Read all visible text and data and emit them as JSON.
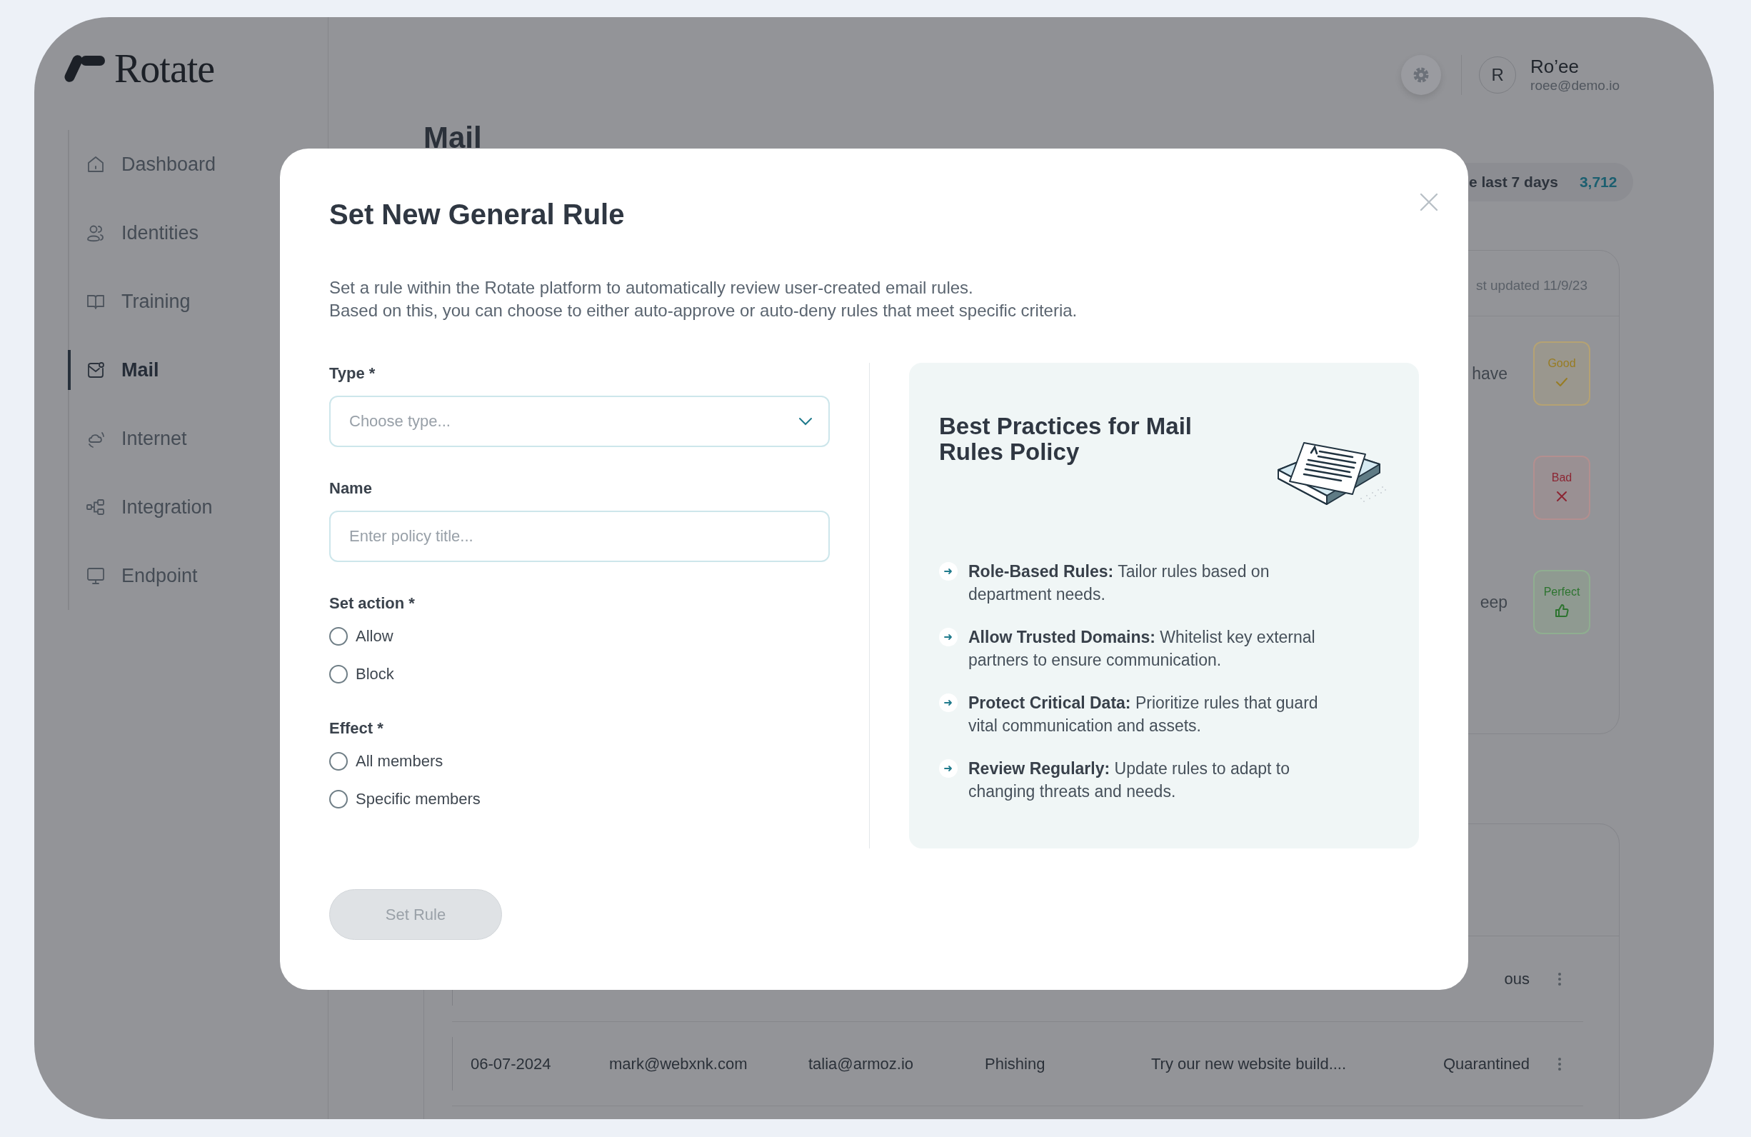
{
  "brand": {
    "name": "Rotate"
  },
  "sidebar": {
    "items": [
      {
        "label": "Dashboard",
        "selected": false
      },
      {
        "label": "Identities",
        "selected": false
      },
      {
        "label": "Training",
        "selected": false
      },
      {
        "label": "Mail",
        "selected": true
      },
      {
        "label": "Internet",
        "selected": false
      },
      {
        "label": "Integration",
        "selected": false
      },
      {
        "label": "Endpoint",
        "selected": false
      }
    ]
  },
  "header": {
    "user": {
      "initial": "R",
      "name": "Ro’ee",
      "email": "roee@demo.io"
    }
  },
  "page": {
    "title": "Mail",
    "stat": {
      "label": "e last 7 days",
      "value": "3,712"
    }
  },
  "rules_card": {
    "updated": "st updated 11/9/23",
    "rows": [
      {
        "text": "have",
        "badge": "Good",
        "kind": "good"
      },
      {
        "badge": "Bad",
        "kind": "bad"
      },
      {
        "text": "eep",
        "badge": "Perfect",
        "kind": "perfect"
      }
    ]
  },
  "table": {
    "rows": [
      {
        "column_6": "ous"
      },
      {
        "column_1": "06-07-2024",
        "column_2": "mark@webxnk.com",
        "column_3": "talia@armoz.io",
        "column_4": "Phishing",
        "column_5": "Try our new website build....",
        "column_6": "Quarantined"
      }
    ]
  },
  "modal": {
    "title": "Set New General Rule",
    "description": [
      "Set a rule within the Rotate platform to automatically review user-created email rules.",
      "Based on this, you can choose to either auto-approve or auto-deny rules that meet specific criteria."
    ],
    "fields": [
      {
        "kind": "select",
        "label": "Type *",
        "placeholder": "Choose type..."
      },
      {
        "kind": "text",
        "label": "Name",
        "placeholder": "Enter policy title..."
      }
    ],
    "radio_groups": [
      {
        "label": "Set action *",
        "options": [
          {
            "label": "Allow",
            "selected": false
          },
          {
            "label": "Block",
            "selected": false
          }
        ]
      },
      {
        "label": "Effect *",
        "options": [
          {
            "label": "All members",
            "selected": false
          },
          {
            "label": "Specific members",
            "selected": false
          }
        ]
      }
    ],
    "tips": {
      "title": "Best Practices for Mail Rules Policy",
      "items": [
        "**Role-Based Rules:** Tailor rules based on department needs.",
        "**Allow Trusted Domains:** Whitelist key external partners to ensure communication.",
        "**Protect Critical Data:** Prioritize rules that guard vital communication and assets.",
        "**Review Regularly:** Update rules to adapt to changing threats and needs."
      ]
    },
    "submit": {
      "label": "Set Rule",
      "disabled": true
    }
  }
}
